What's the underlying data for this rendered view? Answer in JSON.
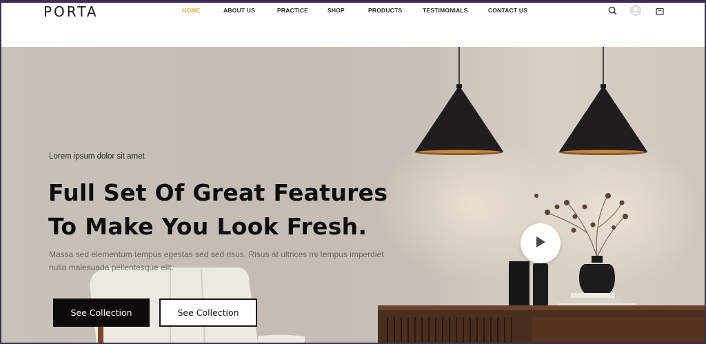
{
  "brand": {
    "logo": "PORTA"
  },
  "nav": {
    "items": [
      {
        "label": "HOME",
        "active": true
      },
      {
        "label": "ABOUT US",
        "active": false
      },
      {
        "label": "PRACTICE",
        "active": false
      },
      {
        "label": "SHOP",
        "active": false
      },
      {
        "label": "PRODUCTS",
        "active": false
      },
      {
        "label": "TESTIMONIALS",
        "active": false
      },
      {
        "label": "CONTACT US",
        "active": false
      }
    ],
    "icons": [
      "search-icon",
      "user-avatar-icon",
      "cart-icon"
    ]
  },
  "hero": {
    "eyebrow": "Lorem ipsum dolor sit amet",
    "headline_line1": "Full Set Of Great Features",
    "headline_line2": "To Make You Look Fresh.",
    "subtext_line1": "Massa sed elementum tempus egestas sed sed risus. Risus at ultrices mi tempus imperdiet",
    "subtext_line2": "nulla malesuada pellentesque elit.",
    "primary_button": "See Collection",
    "secondary_button": "See Collection"
  },
  "colors": {
    "accent": "#e8a93c",
    "dark": "#0d0b0a",
    "window_border": "#3a2f5a"
  }
}
